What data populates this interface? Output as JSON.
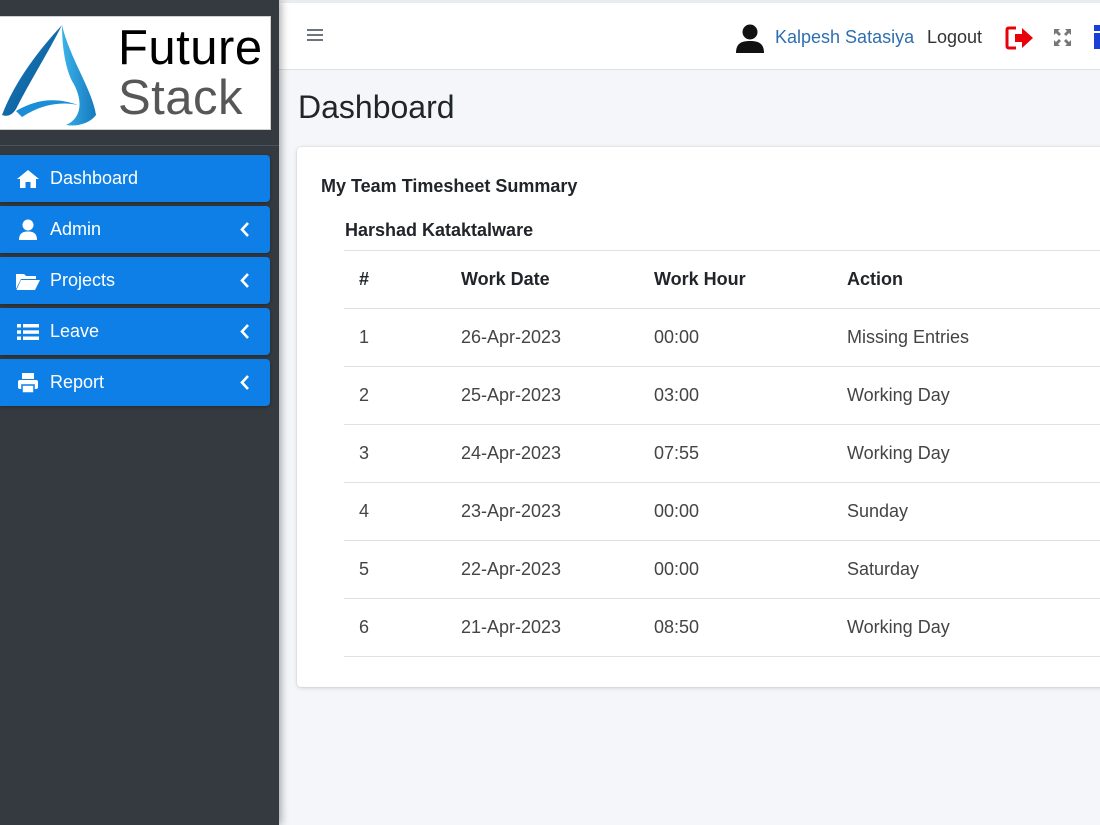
{
  "brand": {
    "word1": "Future",
    "word2": "Stack"
  },
  "sidebar": {
    "items": [
      {
        "label": "Dashboard",
        "icon": "home-icon",
        "has_submenu": false
      },
      {
        "label": "Admin",
        "icon": "user-icon",
        "has_submenu": true
      },
      {
        "label": "Projects",
        "icon": "folder-open-icon",
        "has_submenu": true
      },
      {
        "label": "Leave",
        "icon": "list-icon",
        "has_submenu": true
      },
      {
        "label": "Report",
        "icon": "print-icon",
        "has_submenu": true
      }
    ]
  },
  "topbar": {
    "user_name": "Kalpesh Satasiya",
    "logout_label": "Logout"
  },
  "page": {
    "title": "Dashboard"
  },
  "summary": {
    "title": "My Team Timesheet Summary",
    "member": "Harshad Kataktalware",
    "columns": [
      "#",
      "Work Date",
      "Work Hour",
      "Action"
    ],
    "rows": [
      {
        "num": "1",
        "date": "26-Apr-2023",
        "hours": "00:00",
        "action": "Missing Entries",
        "status": "missing"
      },
      {
        "num": "2",
        "date": "25-Apr-2023",
        "hours": "03:00",
        "action": "Working Day",
        "status": "normal"
      },
      {
        "num": "3",
        "date": "24-Apr-2023",
        "hours": "07:55",
        "action": "Working Day",
        "status": "normal"
      },
      {
        "num": "4",
        "date": "23-Apr-2023",
        "hours": "00:00",
        "action": "Sunday",
        "status": "normal"
      },
      {
        "num": "5",
        "date": "22-Apr-2023",
        "hours": "00:00",
        "action": "Saturday",
        "status": "normal"
      },
      {
        "num": "6",
        "date": "21-Apr-2023",
        "hours": "08:50",
        "action": "Working Day",
        "status": "normal"
      }
    ]
  },
  "colors": {
    "sidebar_bg": "#343a40",
    "nav_active": "#0d7fe6",
    "missing": "#dc3545",
    "user_link": "#2f6fb0",
    "logout_icon": "#e8000b"
  }
}
